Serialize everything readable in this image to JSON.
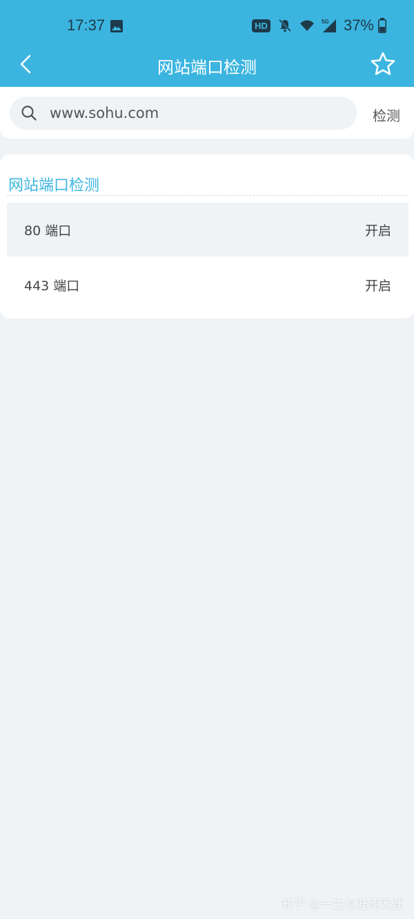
{
  "status_bar": {
    "time": "17:37",
    "hd_badge": "HD",
    "network": "5G",
    "battery": "37%",
    "icons": [
      "image-icon",
      "hd-icon",
      "bell-off-icon",
      "wifi-icon",
      "signal-icon",
      "battery-icon"
    ]
  },
  "nav": {
    "title": "网站端口检测",
    "back_icon": "chevron-left-icon",
    "favorite_icon": "star-icon"
  },
  "search": {
    "value": "www.sohu.com",
    "button_label": "检测",
    "icon": "search-icon"
  },
  "results": {
    "title": "网站端口检测",
    "rows": [
      {
        "label": "80 端口",
        "status": "开启"
      },
      {
        "label": "443 端口",
        "status": "开启"
      }
    ]
  },
  "watermark": "知乎 @一生有涯随无涯",
  "colors": {
    "accent": "#3bb5e0",
    "background": "#eff3f6",
    "card": "#ffffff",
    "text": "#444444"
  }
}
